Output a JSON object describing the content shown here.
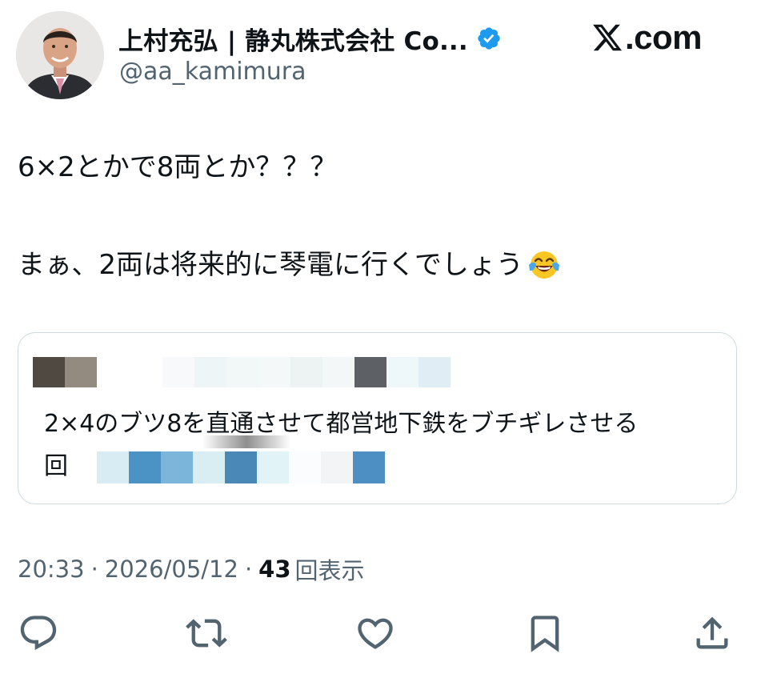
{
  "header": {
    "display_name": "上村充弘 | 静丸株式会社 Co...",
    "handle": "@aa_kamimura",
    "avatar_icon": "avatar-photo",
    "verified_icon": "verified-badge-icon",
    "verified_color": "#1d9bf0",
    "site_logo_text": ".com",
    "site_logo_icon": "x-logo-icon"
  },
  "tweet": {
    "line_1": "6×2とかで8両とか？？？",
    "line_2": "まぁ、2両は将来的に琴電に行くでしょう",
    "line_2_emoji": "face-with-tears-of-joy-icon"
  },
  "quoted_tweet": {
    "text_line_1": "2×4のブツ8を直通させて都営地下鉄をブチギレさせる",
    "text_line_2": "回"
  },
  "meta": {
    "time": "20:33",
    "separator": "·",
    "date": "2026/05/12",
    "views_count": "43",
    "views_label": "回表示"
  },
  "actions": {
    "reply_icon": "reply-icon",
    "repost_icon": "repost-icon",
    "like_icon": "heart-icon",
    "bookmark_icon": "bookmark-icon",
    "share_icon": "share-icon",
    "icon_color": "#536471"
  }
}
